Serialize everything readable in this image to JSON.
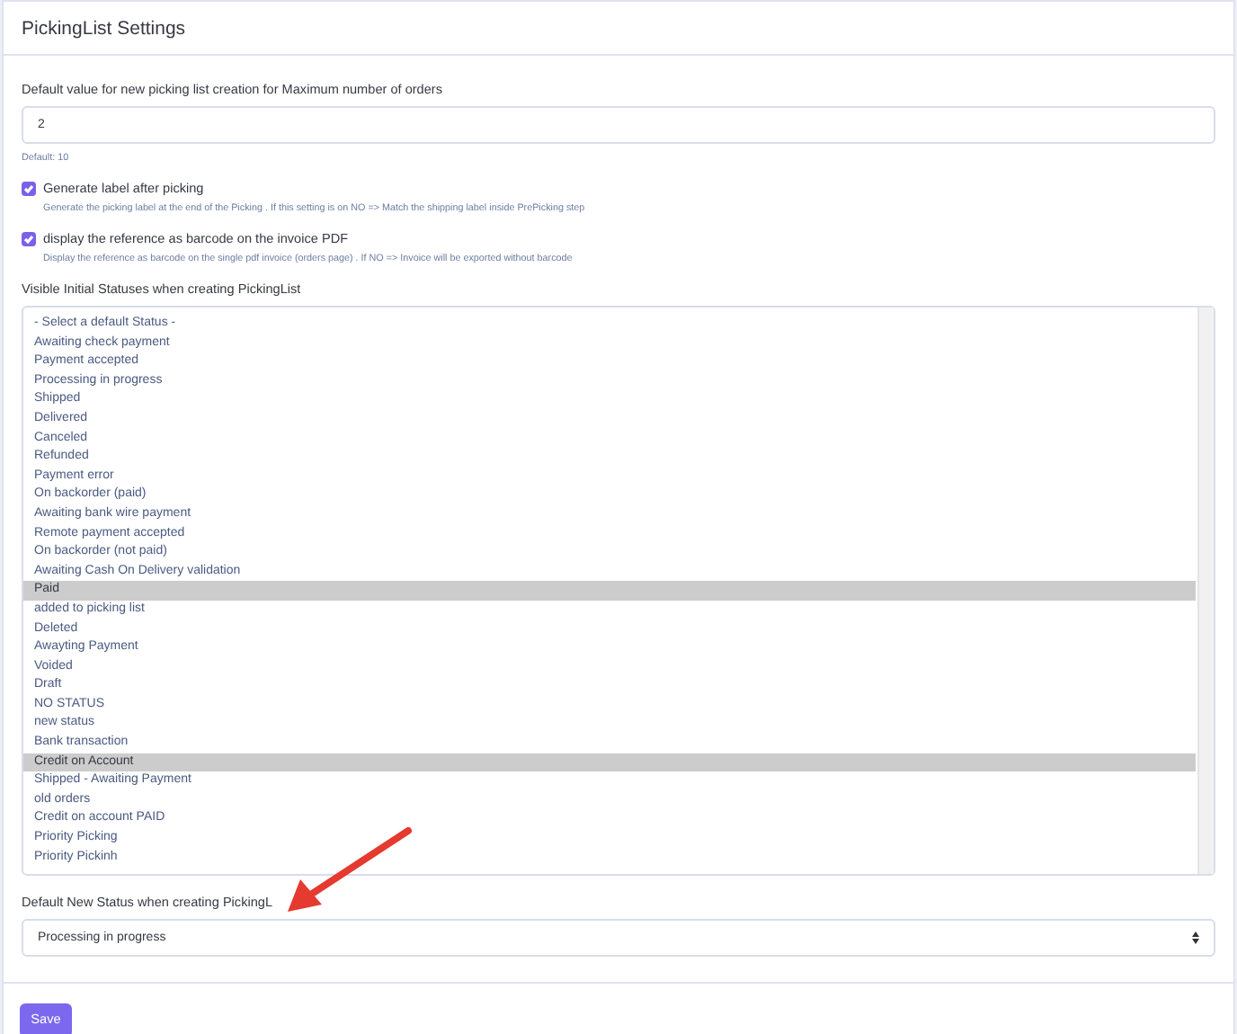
{
  "card": {
    "title": "PickingList Settings"
  },
  "max_orders": {
    "label": "Default value for new picking list creation for Maximum number of orders",
    "value": "2",
    "help": "Default: 10"
  },
  "options": [
    {
      "label": "Generate label after picking",
      "checked": true,
      "help": "Generate the picking label at the end of the Picking . If this setting is on NO => Match the shipping label inside PrePicking step"
    },
    {
      "label": "display the reference as barcode on the invoice PDF",
      "checked": true,
      "help": "Display the reference as barcode on the single pdf invoice (orders page) . If NO => Invoice will be exported without barcode"
    }
  ],
  "statuses": {
    "label": "Visible Initial Statuses when creating PickingList",
    "items": [
      {
        "label": "- Select a default Status -",
        "selected": false
      },
      {
        "label": "Awaiting check payment",
        "selected": false
      },
      {
        "label": "Payment accepted",
        "selected": false
      },
      {
        "label": "Processing in progress",
        "selected": false
      },
      {
        "label": "Shipped",
        "selected": false
      },
      {
        "label": "Delivered",
        "selected": false
      },
      {
        "label": "Canceled",
        "selected": false
      },
      {
        "label": "Refunded",
        "selected": false
      },
      {
        "label": "Payment error",
        "selected": false
      },
      {
        "label": "On backorder (paid)",
        "selected": false
      },
      {
        "label": "Awaiting bank wire payment",
        "selected": false
      },
      {
        "label": "Remote payment accepted",
        "selected": false
      },
      {
        "label": "On backorder (not paid)",
        "selected": false
      },
      {
        "label": "Awaiting Cash On Delivery validation",
        "selected": false
      },
      {
        "label": "Paid",
        "selected": true
      },
      {
        "label": "added to picking list",
        "selected": false
      },
      {
        "label": "Deleted",
        "selected": false
      },
      {
        "label": "Awayting Payment",
        "selected": false
      },
      {
        "label": "Voided",
        "selected": false
      },
      {
        "label": "Draft",
        "selected": false
      },
      {
        "label": "NO STATUS",
        "selected": false
      },
      {
        "label": "new status",
        "selected": false
      },
      {
        "label": "Bank transaction",
        "selected": false
      },
      {
        "label": "Credit on Account",
        "selected": true
      },
      {
        "label": "Shipped - Awaiting Payment",
        "selected": false
      },
      {
        "label": "old orders",
        "selected": false
      },
      {
        "label": "Credit on account PAID",
        "selected": false
      },
      {
        "label": "Priority Picking",
        "selected": false
      },
      {
        "label": "Priority Pickinh",
        "selected": false
      }
    ]
  },
  "default_status": {
    "label": "Default New Status when creating PickingL",
    "value": "Processing in progress"
  },
  "save_button": "Save"
}
